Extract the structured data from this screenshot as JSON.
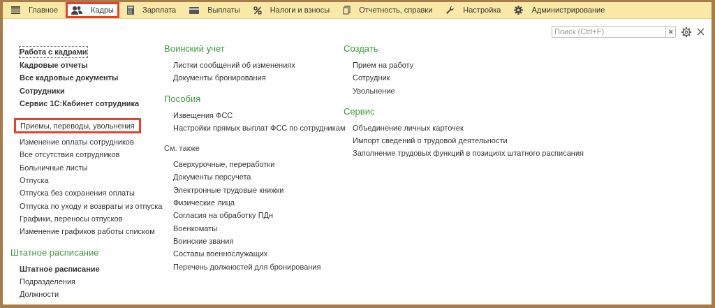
{
  "menu": {
    "tabs": [
      {
        "label": "Главное",
        "selected": false,
        "highlighted": false
      },
      {
        "label": "Кадры",
        "selected": true,
        "highlighted": true
      },
      {
        "label": "Зарплата",
        "selected": false,
        "highlighted": false
      },
      {
        "label": "Выплаты",
        "selected": false,
        "highlighted": false
      },
      {
        "label": "Налоги и взносы",
        "selected": false,
        "highlighted": false
      },
      {
        "label": "Отчетность, справки",
        "selected": false,
        "highlighted": false
      },
      {
        "label": "Настройка",
        "selected": false,
        "highlighted": false
      },
      {
        "label": "Администрирование",
        "selected": false,
        "highlighted": false
      }
    ]
  },
  "search": {
    "placeholder": "Поиск (Ctrl+F)"
  },
  "columns": [
    [
      {
        "items": [
          {
            "label": "Работа с кадрами",
            "bold": true,
            "focused": true,
            "highlighted": false
          },
          {
            "label": "Кадровые отчеты",
            "bold": true,
            "focused": false,
            "highlighted": false
          },
          {
            "label": "Все кадровые документы",
            "bold": true,
            "focused": false,
            "highlighted": false
          },
          {
            "label": "Сотрудники",
            "bold": true,
            "focused": false,
            "highlighted": false
          },
          {
            "label": "Сервис 1С:Кабинет сотрудника",
            "bold": true,
            "focused": false,
            "highlighted": false
          }
        ]
      },
      {
        "items": [
          {
            "label": "Приемы, переводы, увольнения",
            "bold": false,
            "focused": false,
            "highlighted": true
          },
          {
            "label": "Изменение оплаты сотрудников",
            "bold": false,
            "focused": false,
            "highlighted": false
          },
          {
            "label": "Все отсутствия сотрудников",
            "bold": false,
            "focused": false,
            "highlighted": false
          },
          {
            "label": "Больничные листы",
            "bold": false,
            "focused": false,
            "highlighted": false
          },
          {
            "label": "Отпуска",
            "bold": false,
            "focused": false,
            "highlighted": false
          },
          {
            "label": "Отпуска без сохранения оплаты",
            "bold": false,
            "focused": false,
            "highlighted": false
          },
          {
            "label": "Отпуска по уходу и возвраты из отпуска",
            "bold": false,
            "focused": false,
            "highlighted": false
          },
          {
            "label": "Графики, переносы отпусков",
            "bold": false,
            "focused": false,
            "highlighted": false
          },
          {
            "label": "Изменение графиков работы списком",
            "bold": false,
            "focused": false,
            "highlighted": false
          }
        ]
      },
      {
        "kind": "section",
        "title": "Штатное расписание",
        "items": [
          {
            "label": "Штатное расписание",
            "bold": true,
            "focused": false,
            "highlighted": false
          },
          {
            "label": "Подразделения",
            "bold": false,
            "focused": false,
            "highlighted": false
          },
          {
            "label": "Должности",
            "bold": false,
            "focused": false,
            "highlighted": false
          }
        ]
      }
    ],
    [
      {
        "kind": "section",
        "title": "Воинский учет",
        "items": [
          {
            "label": "Листки сообщений об изменениях",
            "bold": false,
            "focused": false,
            "highlighted": false
          },
          {
            "label": "Документы бронирования",
            "bold": false,
            "focused": false,
            "highlighted": false
          }
        ]
      },
      {
        "kind": "section",
        "title": "Пособия",
        "items": [
          {
            "label": "Извещения ФСС",
            "bold": false,
            "focused": false,
            "highlighted": false
          },
          {
            "label": "Настройки прямых выплат ФСС по сотрудникам",
            "bold": false,
            "focused": false,
            "highlighted": false
          }
        ]
      },
      {
        "kind": "see_also",
        "title": "См. также",
        "items": [
          {
            "label": "Сверхурочные, переработки",
            "bold": false,
            "focused": false,
            "highlighted": false
          },
          {
            "label": "Документы персучета",
            "bold": false,
            "focused": false,
            "highlighted": false
          },
          {
            "label": "Электронные трудовые книжки",
            "bold": false,
            "focused": false,
            "highlighted": false
          },
          {
            "label": "Физические лица",
            "bold": false,
            "focused": false,
            "highlighted": false
          },
          {
            "label": "Согласия на обработку ПДн",
            "bold": false,
            "focused": false,
            "highlighted": false
          },
          {
            "label": "Военкоматы",
            "bold": false,
            "focused": false,
            "highlighted": false
          },
          {
            "label": "Воинские звания",
            "bold": false,
            "focused": false,
            "highlighted": false
          },
          {
            "label": "Составы военнослужащих",
            "bold": false,
            "focused": false,
            "highlighted": false
          },
          {
            "label": "Перечень должностей для бронирования",
            "bold": false,
            "focused": false,
            "highlighted": false
          }
        ]
      }
    ],
    [
      {
        "kind": "section",
        "title": "Создать",
        "items": [
          {
            "label": "Прием на работу",
            "bold": false,
            "focused": false,
            "highlighted": false
          },
          {
            "label": "Сотрудник",
            "bold": false,
            "focused": false,
            "highlighted": false
          },
          {
            "label": "Увольнение",
            "bold": false,
            "focused": false,
            "highlighted": false
          }
        ]
      },
      {
        "kind": "section",
        "title": "Сервис",
        "items": [
          {
            "label": "Объединение личных карточек",
            "bold": false,
            "focused": false,
            "highlighted": false
          },
          {
            "label": "Импорт сведений о трудовой деятельности",
            "bold": false,
            "focused": false,
            "highlighted": false
          },
          {
            "label": "Заполнение трудовых функций в позициях штатного расписания",
            "bold": false,
            "focused": false,
            "highlighted": false
          }
        ]
      }
    ]
  ]
}
